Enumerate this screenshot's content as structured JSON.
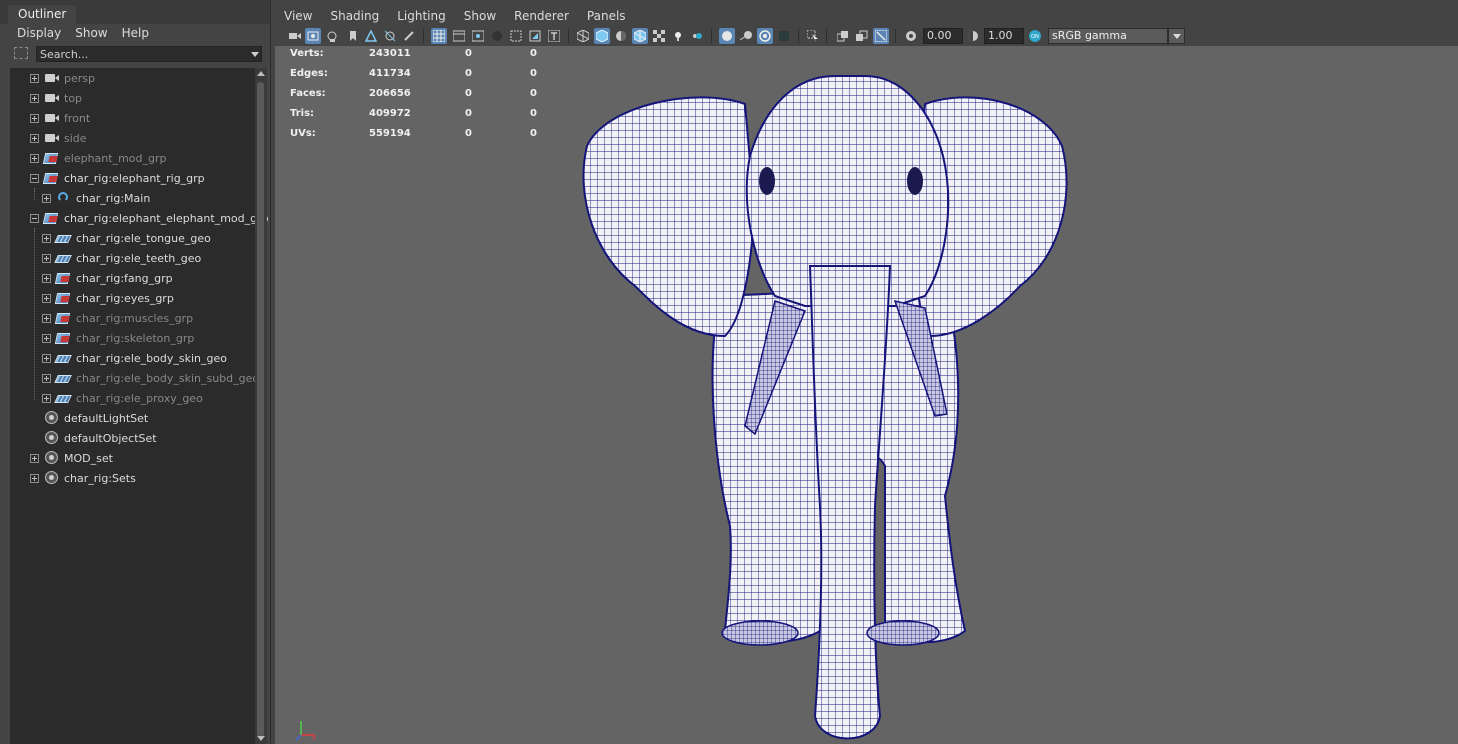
{
  "outliner": {
    "tab_title": "Outliner",
    "menu": [
      "Display",
      "Show",
      "Help"
    ],
    "search_placeholder": "Search...",
    "tree": [
      {
        "label": "persp",
        "icon": "camera-icon",
        "depth": 0,
        "expand": "plus",
        "dim": true
      },
      {
        "label": "top",
        "icon": "camera-icon",
        "depth": 0,
        "expand": "plus",
        "dim": true
      },
      {
        "label": "front",
        "icon": "camera-icon",
        "depth": 0,
        "expand": "plus",
        "dim": true
      },
      {
        "label": "side",
        "icon": "camera-icon",
        "depth": 0,
        "expand": "plus",
        "dim": true
      },
      {
        "label": "elephant_mod_grp",
        "icon": "group-icon",
        "depth": 0,
        "expand": "plus",
        "dim": true
      },
      {
        "label": "char_rig:elephant_rig_grp",
        "icon": "group-icon",
        "depth": 0,
        "expand": "minus",
        "dim": false
      },
      {
        "label": "char_rig:Main",
        "icon": "joint-icon",
        "depth": 1,
        "expand": "plus",
        "dim": false
      },
      {
        "label": "char_rig:elephant_elephant_mod_grp",
        "icon": "group-icon",
        "depth": 0,
        "expand": "minus",
        "dim": false
      },
      {
        "label": "char_rig:ele_tongue_geo",
        "icon": "mesh-icon",
        "depth": 1,
        "expand": "plus",
        "dim": false
      },
      {
        "label": "char_rig:ele_teeth_geo",
        "icon": "mesh-icon",
        "depth": 1,
        "expand": "plus",
        "dim": false
      },
      {
        "label": "char_rig:fang_grp",
        "icon": "group-icon",
        "depth": 1,
        "expand": "plus",
        "dim": false
      },
      {
        "label": "char_rig:eyes_grp",
        "icon": "group-icon",
        "depth": 1,
        "expand": "plus",
        "dim": false
      },
      {
        "label": "char_rig:muscles_grp",
        "icon": "group-icon",
        "depth": 1,
        "expand": "plus",
        "dim": true
      },
      {
        "label": "char_rig:skeleton_grp",
        "icon": "group-icon",
        "depth": 1,
        "expand": "plus",
        "dim": true
      },
      {
        "label": "char_rig:ele_body_skin_geo",
        "icon": "mesh-icon",
        "depth": 1,
        "expand": "plus",
        "dim": false
      },
      {
        "label": "char_rig:ele_body_skin_subd_geo",
        "icon": "mesh-icon",
        "depth": 1,
        "expand": "plus",
        "dim": true
      },
      {
        "label": "char_rig:ele_proxy_geo",
        "icon": "mesh-icon",
        "depth": 1,
        "expand": "plus",
        "dim": true
      },
      {
        "label": "defaultLightSet",
        "icon": "set-icon",
        "depth": 0,
        "expand": "none",
        "dim": false
      },
      {
        "label": "defaultObjectSet",
        "icon": "set-icon",
        "depth": 0,
        "expand": "none",
        "dim": false
      },
      {
        "label": "MOD_set",
        "icon": "set-icon",
        "depth": 0,
        "expand": "plus",
        "dim": false
      },
      {
        "label": "char_rig:Sets",
        "icon": "set-icon",
        "depth": 0,
        "expand": "plus",
        "dim": false
      }
    ]
  },
  "viewport": {
    "menu": [
      "View",
      "Shading",
      "Lighting",
      "Show",
      "Renderer",
      "Panels"
    ],
    "exposure_value": "0.00",
    "gamma_value": "1.00",
    "color_space": "sRGB gamma",
    "accent_color": "#5a85b4",
    "wireframe_color": "#14147a",
    "hud": [
      {
        "label": "Verts:",
        "total": "243011",
        "selected": "0",
        "component": "0"
      },
      {
        "label": "Edges:",
        "total": "411734",
        "selected": "0",
        "component": "0"
      },
      {
        "label": "Faces:",
        "total": "206656",
        "selected": "0",
        "component": "0"
      },
      {
        "label": "Tris:",
        "total": "409972",
        "selected": "0",
        "component": "0"
      },
      {
        "label": "UVs:",
        "total": "559194",
        "selected": "0",
        "component": "0"
      }
    ]
  }
}
